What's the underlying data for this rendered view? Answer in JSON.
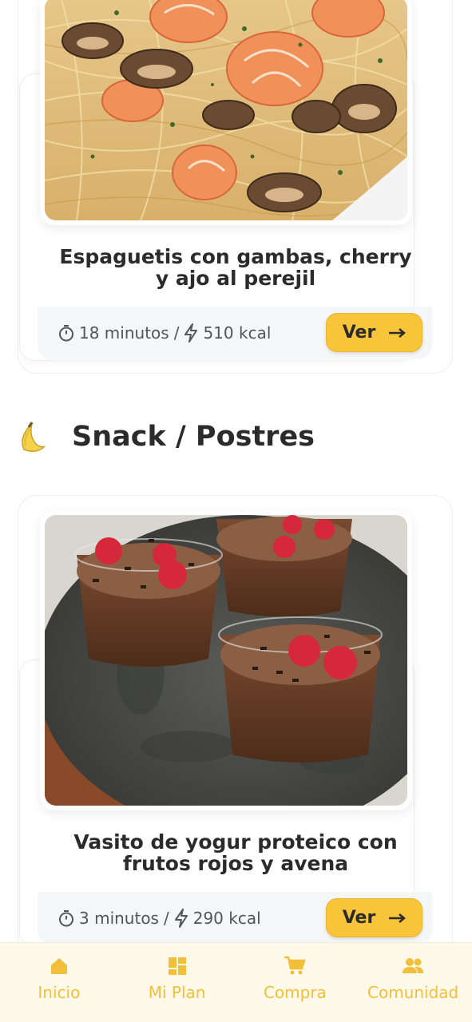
{
  "colors": {
    "accent": "#f8c53a",
    "tab_active": "#f2bf3a",
    "text": "#2b2b2b"
  },
  "recipes": [
    {
      "title_line1": "Espaguetis con gambas, cherry",
      "title_line2": "y ajo al perejil",
      "minutes": "18 minutos",
      "separator": "/",
      "kcal": "510 kcal",
      "button": "Ver",
      "image": "shrimp-mushroom-spaghetti"
    },
    {
      "title_line1": "Vasito de yogur proteico con",
      "title_line2": "frutos rojos y avena",
      "minutes": "3 minutos",
      "separator": "/",
      "kcal": "290 kcal",
      "button": "Ver",
      "image": "chocolate-raspberry-cups"
    }
  ],
  "section": {
    "emoji": "🍌",
    "title": "Snack / Postres"
  },
  "tabbar": {
    "items": [
      {
        "label": "Inicio",
        "icon": "home-icon"
      },
      {
        "label": "Mi Plan",
        "icon": "grid-icon"
      },
      {
        "label": "Compra",
        "icon": "cart-icon"
      },
      {
        "label": "Comunidad",
        "icon": "people-icon"
      }
    ]
  }
}
